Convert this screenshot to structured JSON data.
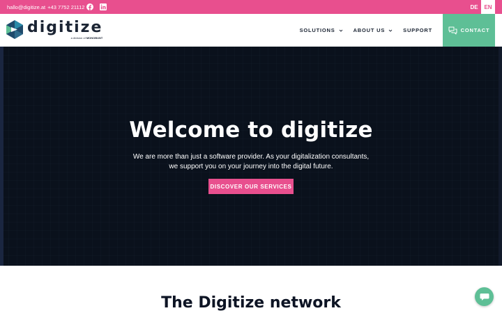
{
  "topbar": {
    "email": "hallo@digitize.at",
    "phone": "+43 7752 21112",
    "social": [
      "facebook-icon",
      "linkedin-icon"
    ],
    "languages": [
      {
        "code": "DE",
        "active": false
      },
      {
        "code": "EN",
        "active": true
      }
    ]
  },
  "header": {
    "logo": {
      "name": "digitize",
      "tagline_prefix": "a division of",
      "tagline_brand": "MONOBUNT"
    },
    "nav": [
      {
        "label": "SOLUTIONS",
        "dropdown": true
      },
      {
        "label": "ABOUT US",
        "dropdown": true
      },
      {
        "label": "SUPPORT",
        "dropdown": false
      }
    ],
    "contact": {
      "label": "CONTACT",
      "icon": "chat-bubbles-icon"
    }
  },
  "hero": {
    "title": "Welcome to digitize",
    "text": "We are more than just a software provider. As your digitalization consultants, we support you on your journey into the digital future.",
    "cta": "DISCOVER OUR SERVICES"
  },
  "network": {
    "title": "The Digitize network"
  },
  "chat": {
    "icon": "chat-icon"
  },
  "colors": {
    "brand_pink": "#e84f8e",
    "brand_green": "#5ebf96",
    "hero_bg": "#0a111c",
    "text_dark": "#0d1424"
  }
}
